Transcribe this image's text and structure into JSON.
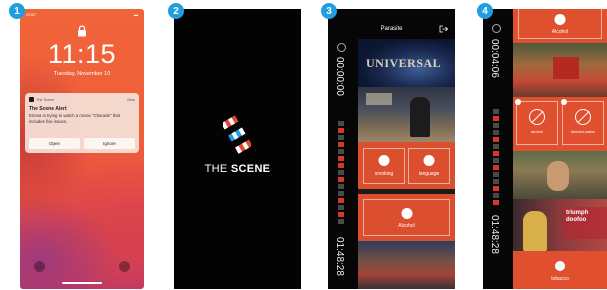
{
  "steps": [
    "1",
    "2",
    "3",
    "4"
  ],
  "lock_screen": {
    "carrier": "AT&T",
    "battery": "▬",
    "time": "11:15",
    "date": "Tuesday, November 10",
    "notification": {
      "app": "The Scene",
      "ago": "Now",
      "title": "The Scene Alert",
      "body": "Emma is trying to watch a movie \"Charade\" that includes five issues.",
      "open_label": "Open",
      "ignore_label": "Ignore"
    }
  },
  "splash": {
    "brand_light": "THE ",
    "brand_bold": "SCENE",
    "logo_colors": [
      "#e8472d",
      "#1f9fe0"
    ]
  },
  "player": {
    "title": "Parasite",
    "time_start": "00:00:00",
    "time_end": "01:48:28",
    "frame_text": "UNIVERSAL",
    "categories": {
      "smoking": "smoking",
      "language": "language",
      "alcohol": "Alcohol"
    }
  },
  "player2": {
    "time_start": "00:04:06",
    "time_end": "01:48:28",
    "top_label": "Alcohol",
    "mid_left": "alcohol",
    "mid_right": "discrimi-nation",
    "bottom_label": "tobacco",
    "ticker": "triumph doofoo"
  },
  "colors": {
    "accent_orange": "#e85330",
    "accent_blue": "#1f9fe0"
  }
}
